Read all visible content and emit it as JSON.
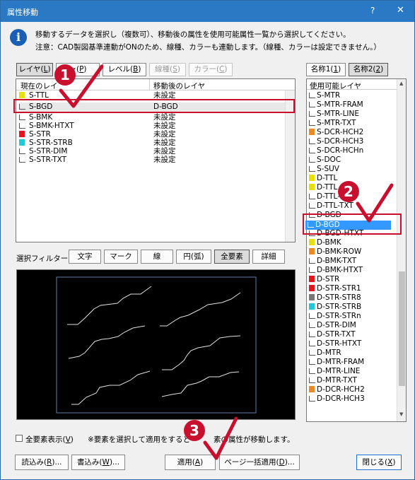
{
  "title": "属性移動",
  "title_buttons": {
    "help": "?",
    "close": "✕"
  },
  "message": {
    "line1": "移動するデータを選択し（複数可）、移動後の属性を使用可能属性一覧から選択してください。",
    "line2": "注意：CAD製図基準連動がONのため、線種、カラーも連動します。（線種、カラーは設定できません。）"
  },
  "tabs": [
    {
      "key": "layer",
      "label": "レイヤ(",
      "mn": "L",
      "end": ")"
    },
    {
      "key": "p",
      "label": "ャ(",
      "mn": "P",
      "end": ")"
    },
    {
      "key": "level",
      "label": "レベル(",
      "mn": "B",
      "end": ")"
    },
    {
      "key": "linetype",
      "label": "線種(",
      "mn": "S",
      "end": ")"
    },
    {
      "key": "color",
      "label": "カラー(",
      "mn": "C",
      "end": ")"
    }
  ],
  "left_list": {
    "header": {
      "current": "現在のレイ",
      "after": "移動後のレイヤ"
    },
    "rows": [
      {
        "name": "S-TTL",
        "after": "未設定",
        "swatch": "#e8e000"
      },
      {
        "name": "S-BGD",
        "after": "D-BGD",
        "swatch": ""
      },
      {
        "name": "S-BMK",
        "after": "未設定",
        "swatch": ""
      },
      {
        "name": "S-BMK-HTXT",
        "after": "未設定",
        "swatch": ""
      },
      {
        "name": "S-STR",
        "after": "未設定",
        "swatch": "#e8141b"
      },
      {
        "name": "S-STR-STRB",
        "after": "未設定",
        "swatch": "#20c8d8"
      },
      {
        "name": "S-STR-DIM",
        "after": "未設定",
        "swatch": ""
      },
      {
        "name": "S-STR-TXT",
        "after": "未設定",
        "swatch": ""
      }
    ]
  },
  "right_tabs": [
    {
      "label": "名称1(",
      "mn": "1",
      "end": ")"
    },
    {
      "label": "名称2(",
      "mn": "2",
      "end": ")"
    }
  ],
  "right_list": {
    "header": "使用可能レイヤ",
    "items": [
      {
        "name": "S-MTR",
        "swatch": ""
      },
      {
        "name": "S-MTR-FRAM",
        "swatch": ""
      },
      {
        "name": "S-MTR-LINE",
        "swatch": ""
      },
      {
        "name": "S-MTR-TXT",
        "swatch": ""
      },
      {
        "name": "S-DCR-HCH2",
        "swatch": "#f08a20"
      },
      {
        "name": "S-DCR-HCH3",
        "swatch": ""
      },
      {
        "name": "S-DCR-HCHn",
        "swatch": ""
      },
      {
        "name": "S-DOC",
        "swatch": ""
      },
      {
        "name": "S-SUV",
        "swatch": ""
      },
      {
        "name": "D-TTL",
        "swatch": "#e8e000"
      },
      {
        "name": "D-TTL",
        "swatch": "#e8e000"
      },
      {
        "name": "D-TTL-",
        "swatch": ""
      },
      {
        "name": "D-TTL-TXT",
        "swatch": ""
      },
      {
        "name": "D-BGD",
        "swatch": ""
      },
      {
        "name": "D-BGD-TXT",
        "swatch": ""
      },
      {
        "name": "D-BGD-HTXT",
        "swatch": ""
      },
      {
        "name": "D-BMK",
        "swatch": "#e8e000"
      },
      {
        "name": "D-BMK-ROW",
        "swatch": "#f08a20"
      },
      {
        "name": "D-BMK-TXT",
        "swatch": ""
      },
      {
        "name": "D-BMK-HTXT",
        "swatch": ""
      },
      {
        "name": "D-STR",
        "swatch": "#e8141b"
      },
      {
        "name": "D-STR-STR1",
        "swatch": "#e8141b"
      },
      {
        "name": "D-STR-STR8",
        "swatch": "#777777"
      },
      {
        "name": "D-STR-STRB",
        "swatch": "#20c8d8"
      },
      {
        "name": "D-STR-STRn",
        "swatch": ""
      },
      {
        "name": "D-STR-DIM",
        "swatch": ""
      },
      {
        "name": "D-STR-TXT",
        "swatch": ""
      },
      {
        "name": "D-STR-HTXT",
        "swatch": ""
      },
      {
        "name": "D-MTR",
        "swatch": ""
      },
      {
        "name": "D-MTR-FRAM",
        "swatch": ""
      },
      {
        "name": "D-MTR-LINE",
        "swatch": ""
      },
      {
        "name": "D-MTR-TXT",
        "swatch": ""
      },
      {
        "name": "D-DCR-HCH2",
        "swatch": "#f08a20"
      },
      {
        "name": "D-DCR-HCH3",
        "swatch": ""
      }
    ]
  },
  "filter": {
    "label": "選択フィルター",
    "buttons": [
      "文字",
      "マーク",
      "線",
      "円(弧)",
      "全要素",
      "詳細"
    ]
  },
  "show_all": {
    "label": "全要素表示(",
    "mn": "V",
    "end": ")"
  },
  "note": "※要素を選択して適用をすると",
  "note_tail": "素の属性が移動します。",
  "buttons": {
    "load": {
      "label": "読込み(",
      "mn": "R",
      "end": ")..."
    },
    "save": {
      "label": "書込み(",
      "mn": "W",
      "end": ")..."
    },
    "apply": {
      "label": "適用(",
      "mn": "A",
      "end": ")"
    },
    "page": {
      "label": "ページ一括適用(",
      "mn": "D",
      "end": ")..."
    },
    "close": {
      "label": "閉じる(",
      "mn": "X",
      "end": ")"
    }
  },
  "callouts": [
    "1",
    "2",
    "3"
  ],
  "colors": {
    "title": "#2b78c4",
    "accent": "#c8102e",
    "selection": "#3399ff"
  }
}
